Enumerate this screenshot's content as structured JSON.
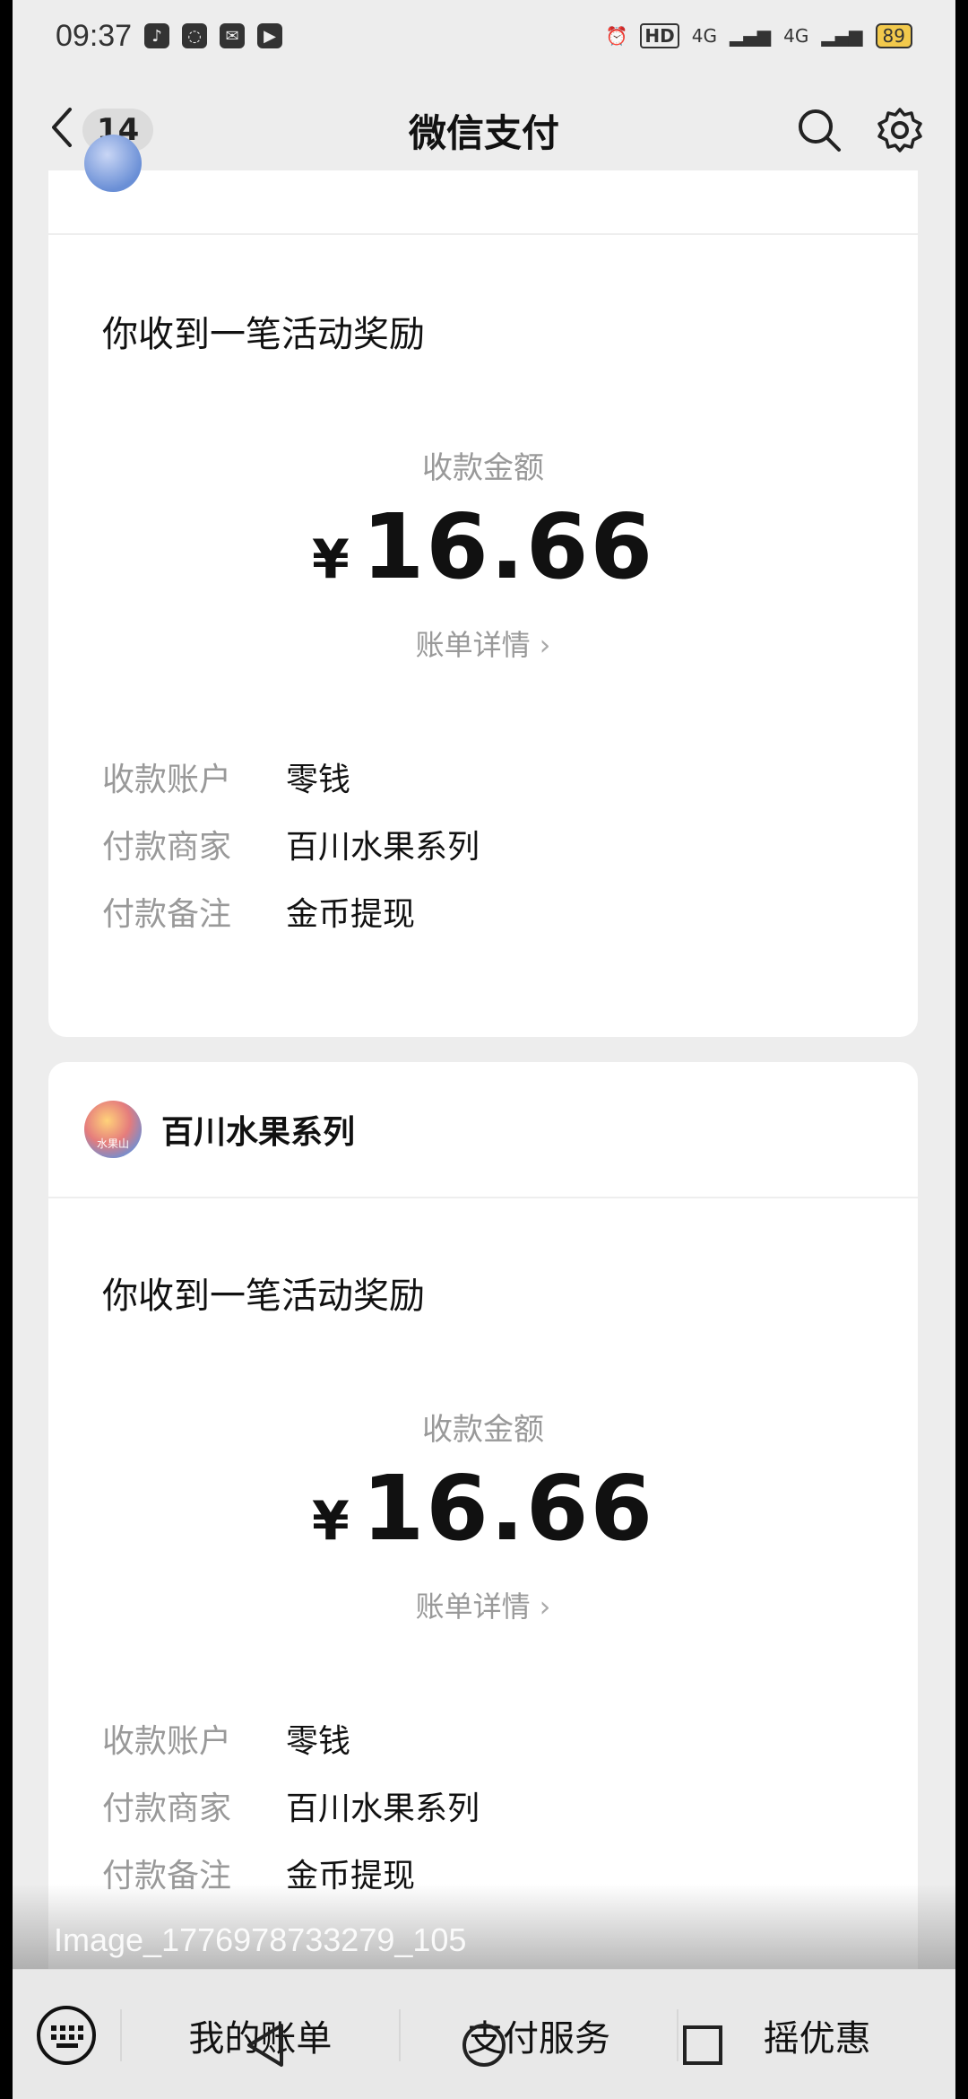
{
  "status_bar": {
    "time": "09:37",
    "signal1": "4G",
    "signal2": "4G",
    "hd_badge": "HD",
    "battery": "89"
  },
  "nav": {
    "back_count": "14",
    "title": "微信支付"
  },
  "cards": [
    {
      "message_title": "你收到一笔活动奖励",
      "amount_label": "收款金额",
      "currency": "¥",
      "amount": "16.66",
      "detail_link": "账单详情",
      "rows": [
        {
          "key": "收款账户",
          "value": "零钱"
        },
        {
          "key": "付款商家",
          "value": "百川水果系列"
        },
        {
          "key": "付款备注",
          "value": "金币提现"
        }
      ]
    },
    {
      "merchant_name": "百川水果系列",
      "avatar_text": "水果山",
      "message_title": "你收到一笔活动奖励",
      "amount_label": "收款金额",
      "currency": "¥",
      "amount": "16.66",
      "detail_link": "账单详情",
      "rows": [
        {
          "key": "收款账户",
          "value": "零钱"
        },
        {
          "key": "付款商家",
          "value": "百川水果系列"
        },
        {
          "key": "付款备注",
          "value": "金币提现"
        }
      ]
    }
  ],
  "watermark": "Image_1776978733279_105",
  "bottom_menu": [
    "我的账单",
    "支付服务",
    "摇优惠"
  ],
  "icons": {
    "search": "search-icon",
    "settings": "gear-icon",
    "keyboard": "keyboard-icon"
  }
}
